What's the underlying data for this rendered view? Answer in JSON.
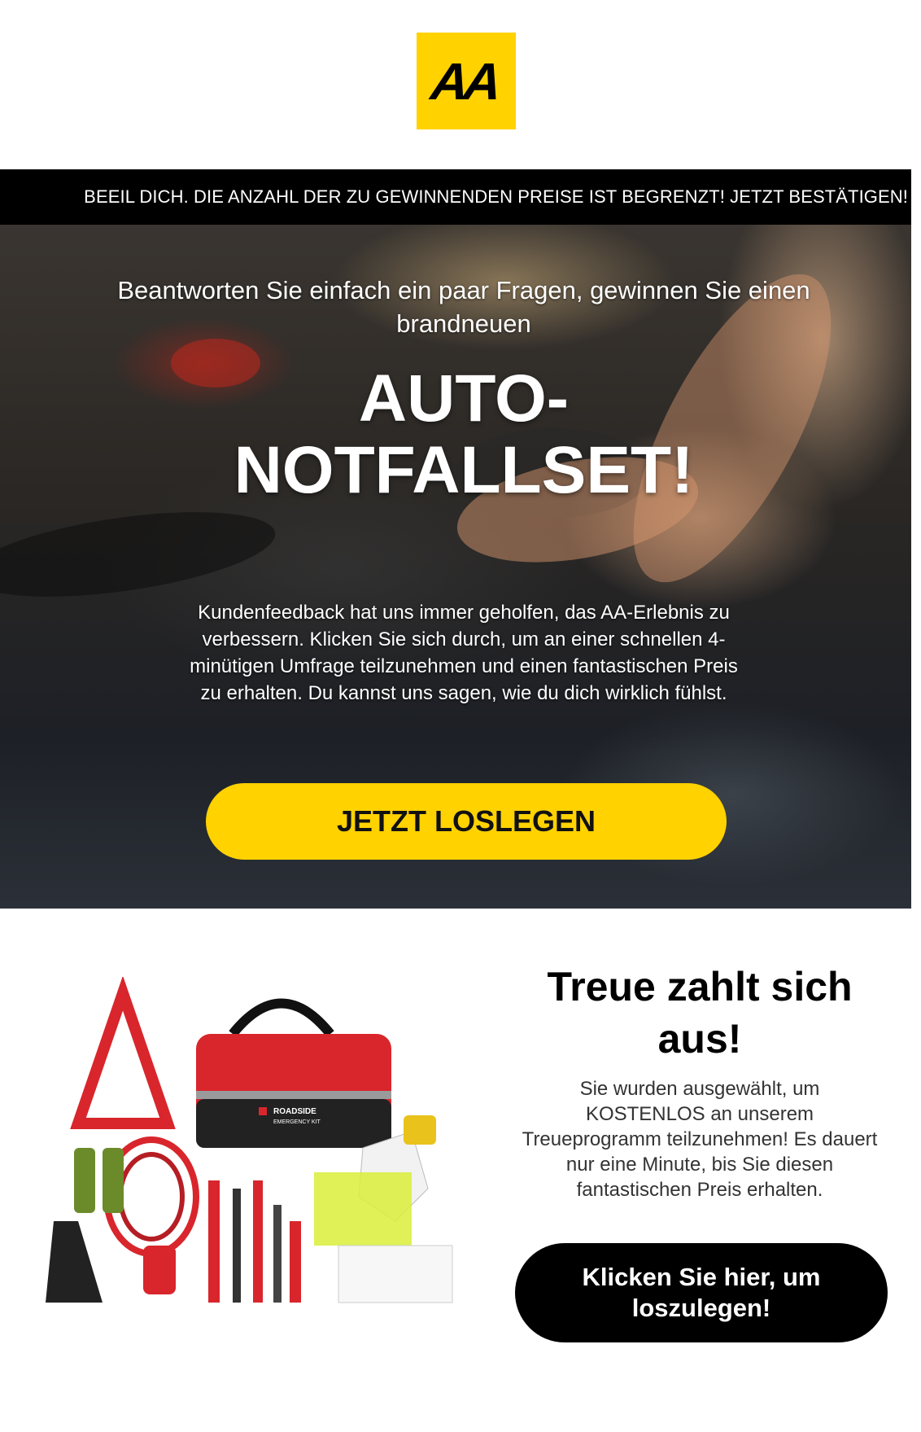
{
  "brand": {
    "logo_text": "AA",
    "logo_color": "#ffd200"
  },
  "urgency_bar": {
    "text": "BEEIL DICH. DIE ANZAHL DER ZU GEWINNENDEN PREISE IST BEGRENZT! JETZT BESTÄTIGEN!"
  },
  "hero": {
    "subtitle": "Beantworten Sie einfach ein paar Fragen, gewinnen Sie einen brandneuen",
    "title": "AUTO-NOTFALLSET!",
    "body": "Kundenfeedback hat uns immer geholfen, das AA-Erlebnis zu verbessern. Klicken Sie sich durch, um an einer schnellen 4-minütigen Umfrage teilzunehmen und einen fantastischen Preis zu erhalten. Du kannst uns sagen, wie du dich wirklich fühlst.",
    "cta_label": "JETZT LOSLEGEN",
    "cta_color": "#ffd200"
  },
  "product": {
    "bag_label_line1": "ROADSIDE",
    "bag_label_line2": "EMERGENCY KIT"
  },
  "promo": {
    "title": "Treue zahlt sich aus!",
    "body": "Sie wurden ausgewählt, um KOSTENLOS an unserem Treueprogramm teilzunehmen! Es dauert nur eine Minute, bis Sie diesen fantastischen Preis erhalten.",
    "cta_label": "Klicken Sie hier, um loszulegen!"
  }
}
